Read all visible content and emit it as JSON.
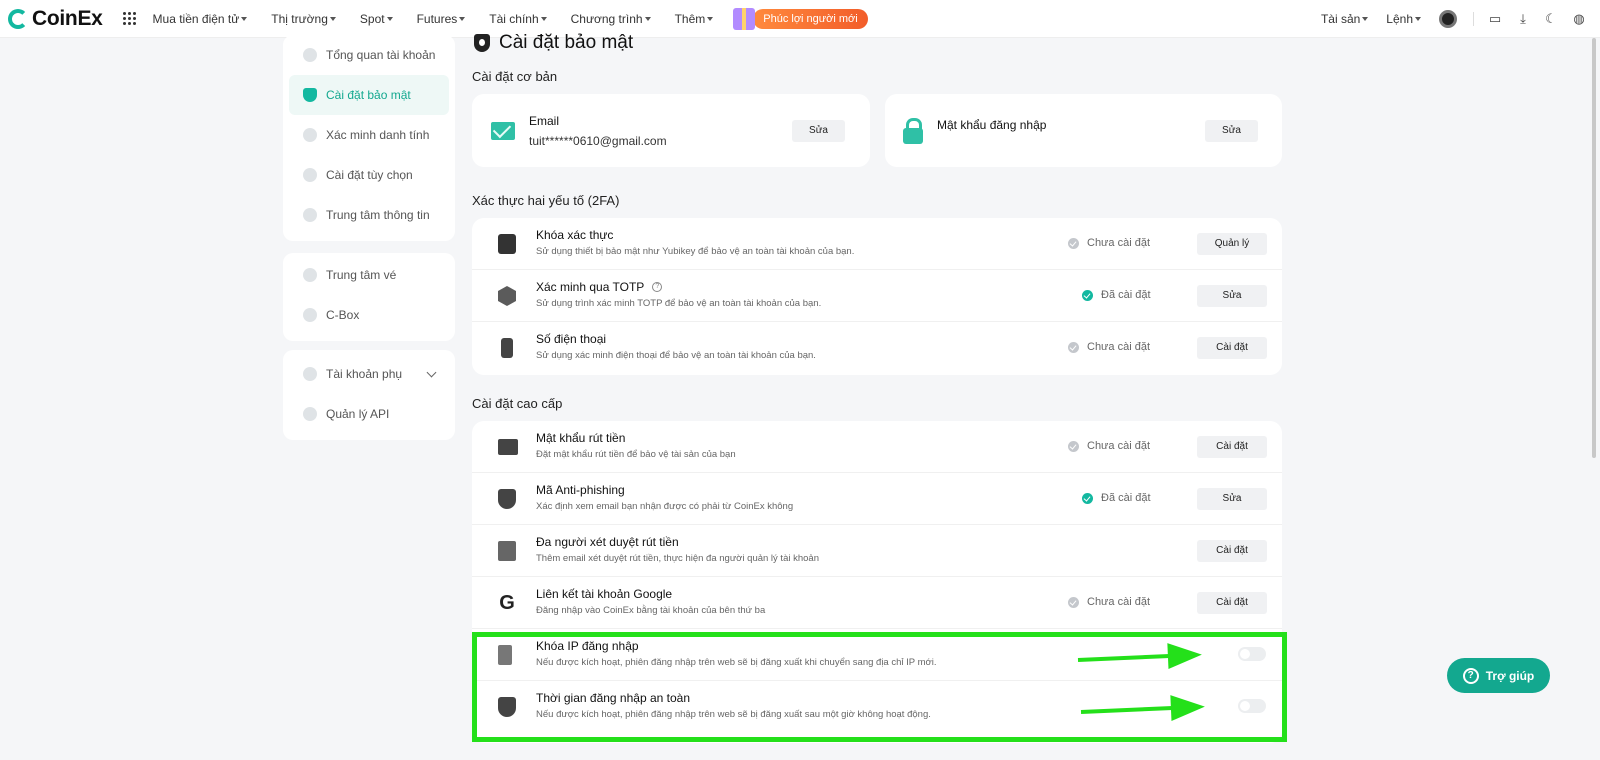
{
  "header": {
    "logo_text": "CoinEx",
    "nav": [
      "Mua tiền điện tử",
      "Thị trường",
      "Spot",
      "Futures",
      "Tài chính",
      "Chương trình",
      "Thêm"
    ],
    "promo": "Phúc lợi người mới",
    "right": {
      "assets": "Tài sản",
      "orders": "Lệnh"
    }
  },
  "sidebar": {
    "group1": [
      "Tổng quan tài khoản",
      "Cài đặt bảo mật",
      "Xác minh danh tính",
      "Cài đặt tùy chọn",
      "Trung tâm thông tin"
    ],
    "group2": [
      "Trung tâm vé",
      "C-Box"
    ],
    "group3": [
      "Tài khoản phụ",
      "Quản lý API"
    ]
  },
  "page": {
    "title": "Cài đặt bảo mật"
  },
  "basic": {
    "heading": "Cài đặt cơ bản",
    "email_label": "Email",
    "email_value": "tuit******0610@gmail.com",
    "email_button": "Sửa",
    "password_label": "Mật khẩu đăng nhập",
    "password_button": "Sửa"
  },
  "twofa": {
    "heading": "Xác thực hai yếu tố (2FA)",
    "rows": [
      {
        "title": "Khóa xác thực",
        "desc": "Sử dụng thiết bị bảo mật như Yubikey để bảo vệ an toàn tài khoản của bạn.",
        "status": "Chưa cài đặt",
        "button": "Quản lý"
      },
      {
        "title": "Xác minh qua TOTP",
        "desc": "Sử dụng trình xác minh TOTP để bảo vệ an toàn tài khoản của bạn.",
        "status": "Đã cài đặt",
        "button": "Sửa"
      },
      {
        "title": "Số điện thoại",
        "desc": "Sử dụng xác minh điện thoại để bảo vệ an toàn tài khoản của bạn.",
        "status": "Chưa cài đặt",
        "button": "Cài đặt"
      }
    ]
  },
  "advanced": {
    "heading": "Cài đặt cao cấp",
    "rows": [
      {
        "title": "Mật khẩu rút tiền",
        "desc": "Đặt mật khẩu rút tiền để bảo vệ tài sản của bạn",
        "status": "Chưa cài đặt",
        "button": "Cài đặt"
      },
      {
        "title": "Mã Anti-phishing",
        "desc": "Xác định xem email bạn nhận được có phải từ CoinEx không",
        "status": "Đã cài đặt",
        "button": "Sửa"
      },
      {
        "title": "Đa người xét duyệt rút tiền",
        "desc": "Thêm email xét duyệt rút tiền, thực hiện đa người quản lý tài khoản",
        "button": "Cài đặt"
      },
      {
        "title": "Liên kết tài khoản Google",
        "desc": "Đăng nhập vào CoinEx bằng tài khoản của bên thứ ba",
        "status": "Chưa cài đặt",
        "button": "Cài đặt"
      },
      {
        "title": "Khóa IP đăng nhập",
        "desc": "Nếu được kích hoạt, phiên đăng nhập trên web sẽ bị đăng xuất khi chuyển sang địa chỉ IP mới."
      },
      {
        "title": "Thời gian đăng nhập an toàn",
        "desc": "Nếu được kích hoạt, phiên đăng nhập trên web sẽ bị đăng xuất sau một giờ không hoạt động."
      }
    ]
  },
  "help": {
    "label": "Trợ giúp"
  },
  "colors": {
    "accent": "#13b8a0",
    "highlight": "#24e01a",
    "promo": "#f25d2a"
  }
}
